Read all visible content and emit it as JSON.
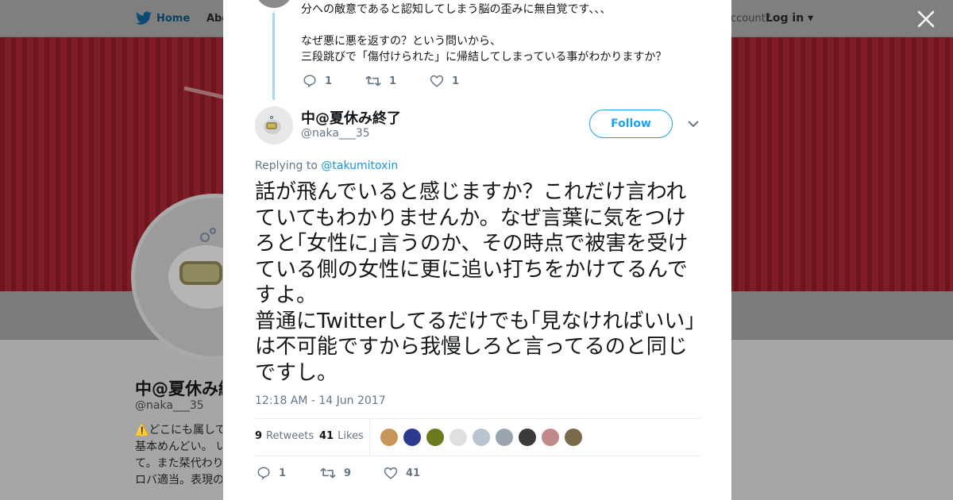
{
  "background": {
    "nav": {
      "home_label": "Home",
      "about_label": "Abo",
      "account_prompt": "ccount?",
      "login_label": "Log in"
    },
    "profile": {
      "name": "中@夏休み終了",
      "handle": "@naka___35",
      "bio_lines": [
        "⚠️どこにも属して",
        "基本めんどい。 い",
        "て。また栞代わり",
        "ロバ適当。表現の"
      ]
    }
  },
  "previous_tweet": {
    "text": "分への敵意であると認知してしまう脳の歪みに無自覚です、、、\n\nなぜ悪に悪を返すの？という問いから、\n三段跳びで「傷付けられた」に帰結してしまっている事がわかりますか？",
    "replies": "1",
    "retweets": "1",
    "likes": "1"
  },
  "tweet": {
    "author_name": "中@夏休み終了",
    "author_handle": "@naka___35",
    "follow_label": "Follow",
    "replying_label": "Replying to",
    "replying_to": "@takumitoxin",
    "text": "話が飛んでいると感じますか？これだけ言われていてもわかりませんか。なぜ言葉に気をつけろと｢女性に｣言うのか、その時点で被害を受けている側の女性に更に追い打ちをかけてるんですよ。\n普通にTwitterしてるだけでも｢見なければいい｣は不可能ですから我慢しろと言ってるのと同じですし。",
    "timestamp": "12:18 AM - 14 Jun 2017",
    "retweet_count": "9",
    "retweet_label": "Retweets",
    "like_count": "41",
    "like_label": "Likes",
    "footer": {
      "replies": "1",
      "retweets": "9",
      "likes": "41"
    }
  },
  "colors": {
    "accent": "#1da1f2",
    "link": "#1b95e0",
    "muted": "#657786",
    "thread_line": "#a6d5f5"
  }
}
